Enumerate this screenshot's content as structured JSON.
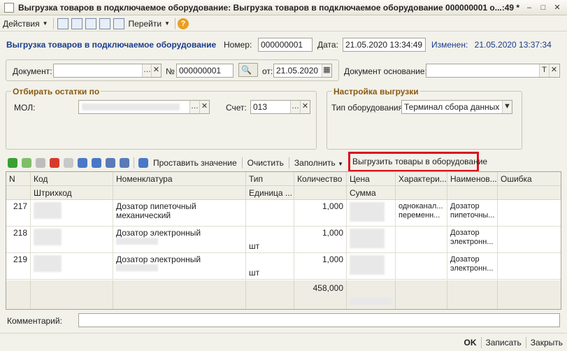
{
  "window": {
    "title": "Выгрузка товаров в подключаемое оборудование: Выгрузка товаров в подключаемое оборудование 000000001 о...:49 *",
    "minimize": "–",
    "maximize": "□",
    "close": "✕"
  },
  "toolbar": {
    "actions_label": "Действия",
    "goto_label": "Перейти",
    "help": "?"
  },
  "header": {
    "doc_title": "Выгрузка товаров в подключаемое оборудование",
    "number_label": "Номер:",
    "number_value": "000000001",
    "date_label": "Дата:",
    "date_value": "21.05.2020 13:34:49",
    "changed_label": "Изменен:",
    "changed_value": "21.05.2020 13:37:34"
  },
  "document_row": {
    "document_label": "Документ:",
    "document_value": "",
    "no_label": "№",
    "no_value": "000000001",
    "from_label": "от:",
    "from_value": "21.05.2020",
    "basis_label": "Документ основание:",
    "basis_value": ""
  },
  "filter_group": {
    "title": "Отбирать остатки по",
    "mol_label": "МОЛ:",
    "account_label": "Счет:",
    "account_value": "013"
  },
  "export_group": {
    "title": "Настройка выгрузки",
    "equipment_type_label": "Тип оборудования:",
    "equipment_type_value": "Терминал сбора данных"
  },
  "table_toolbar": {
    "set_value": "Проставить значение",
    "clear": "Очистить",
    "fill": "Заполнить",
    "export": "Выгрузить товары в оборудование"
  },
  "table": {
    "headers_top": [
      "N",
      "Код",
      "Номенклатура",
      "Тип",
      "Количество",
      "Цена",
      "Характери...",
      "Наименов...",
      "Ошибка"
    ],
    "headers_bottom": [
      "Штрихкод",
      "Единица ...",
      "Сумма"
    ],
    "rows": [
      {
        "n": "217",
        "nomenclature": "Дозатор пипеточный механический",
        "type": "",
        "unit": "",
        "qty": "1,000",
        "char": "одноканал... переменн...",
        "name": "Дозатор пипеточны..."
      },
      {
        "n": "218",
        "nomenclature": "Дозатор электронный",
        "type": "",
        "unit": "шт",
        "qty": "1,000",
        "char": "",
        "name": "Дозатор электронн..."
      },
      {
        "n": "219",
        "nomenclature": "Дозатор электронный",
        "type": "",
        "unit": "шт",
        "qty": "1,000",
        "char": "",
        "name": "Дозатор электронн..."
      }
    ],
    "total_qty": "458,000"
  },
  "footer": {
    "comment_label": "Комментарий:",
    "ok": "OK",
    "save": "Записать",
    "close": "Закрыть"
  }
}
